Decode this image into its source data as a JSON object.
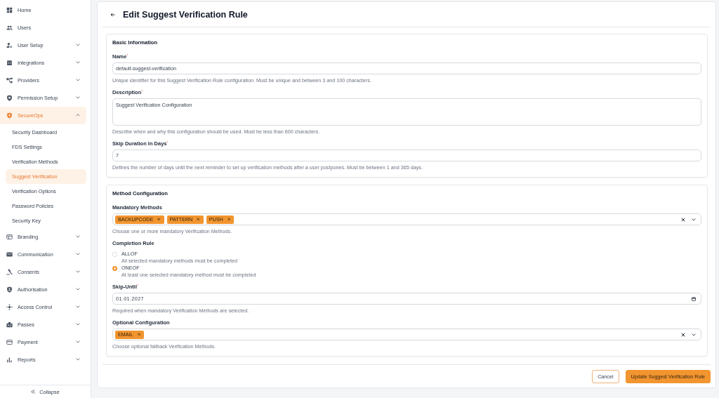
{
  "sidebar": {
    "items": [
      {
        "label": "Home",
        "kind": "link",
        "selected": false
      },
      {
        "label": "Users",
        "kind": "link",
        "selected": false
      },
      {
        "label": "User Setup",
        "kind": "group",
        "selected": false,
        "expanded": false
      },
      {
        "label": "Integrations",
        "kind": "group",
        "selected": false,
        "expanded": false
      },
      {
        "label": "Providers",
        "kind": "group",
        "selected": false,
        "expanded": false
      },
      {
        "label": "Permission Setup",
        "kind": "group",
        "selected": false,
        "expanded": false
      },
      {
        "label": "SecureOps",
        "kind": "group",
        "selected": true,
        "expanded": true,
        "children": [
          {
            "label": "Security Dashboard",
            "selected": false
          },
          {
            "label": "FDS Settings",
            "selected": false
          },
          {
            "label": "Verification Methods",
            "selected": false
          },
          {
            "label": "Suggest Verification",
            "selected": true
          },
          {
            "label": "Verification Options",
            "selected": false
          },
          {
            "label": "Password Policies",
            "selected": false
          },
          {
            "label": "Security Key",
            "selected": false
          }
        ]
      },
      {
        "label": "Branding",
        "kind": "group",
        "selected": false,
        "expanded": false
      },
      {
        "label": "Communication",
        "kind": "group",
        "selected": false,
        "expanded": false
      },
      {
        "label": "Consents",
        "kind": "group",
        "selected": false,
        "expanded": false
      },
      {
        "label": "Authorisation",
        "kind": "group",
        "selected": false,
        "expanded": false
      },
      {
        "label": "Access Control",
        "kind": "group",
        "selected": false,
        "expanded": false
      },
      {
        "label": "Passes",
        "kind": "group",
        "selected": false,
        "expanded": false
      },
      {
        "label": "Payment",
        "kind": "group",
        "selected": false,
        "expanded": false
      },
      {
        "label": "Reports",
        "kind": "group",
        "selected": false,
        "expanded": false
      }
    ],
    "collapse_label": "Collapse"
  },
  "page": {
    "title": "Edit Suggest Verification Rule"
  },
  "sections": [
    {
      "title": "Basic Information",
      "fields": [
        {
          "kind": "text",
          "label": "Name$^{*}$",
          "value": "default-suggest-verification",
          "help": "Unique identifier for this Suggest Verification Rule configuration. Must be unique and between 3 and 100 characters."
        },
        {
          "kind": "textarea",
          "label": "Description$^{*}$",
          "value": "Suggest Verification Configuration",
          "help": "Describe when and why this configuration should be used. Must be less than 600 characters."
        },
        {
          "kind": "text",
          "label": "Skip Duration In Days$^{*}$",
          "value": "7",
          "help": "Defines the number of days until the next reminder to set up verification methods after a user postpones. Must be between 1 and 365 days."
        }
      ]
    },
    {
      "title": "Method Configuration",
      "fields": [
        {
          "kind": "multiselect",
          "label": "Mandatory Methods",
          "chips": [
            "BACKUPCODE",
            "PATTERN",
            "PUSH"
          ],
          "help": "Choose one or more mandatory Verification Methods."
        },
        {
          "kind": "radio",
          "label": "Completion Rule",
          "options": [
            {
              "label": "ALLOF",
              "description": "All selected mandatory methods must be completed",
              "selected": false
            },
            {
              "label": "ONEOF",
              "description": "At least one selected mandatory method must be completed",
              "selected": true
            }
          ]
        },
        {
          "kind": "date",
          "label": "Skip-Until$^{*}$",
          "value": "01.01.2027",
          "help": "Required when mandatory Verification Methods are selected."
        },
        {
          "kind": "multiselect",
          "label": "Optional Configuration",
          "chips": [
            "EMAIL"
          ],
          "help": "Choose optional fallback Verification Methods."
        }
      ]
    }
  ],
  "actions": [
    {
      "label": "Cancel",
      "kind": "secondary"
    },
    {
      "label": "Update Suggest Verification Rule",
      "kind": "primary"
    }
  ]
}
